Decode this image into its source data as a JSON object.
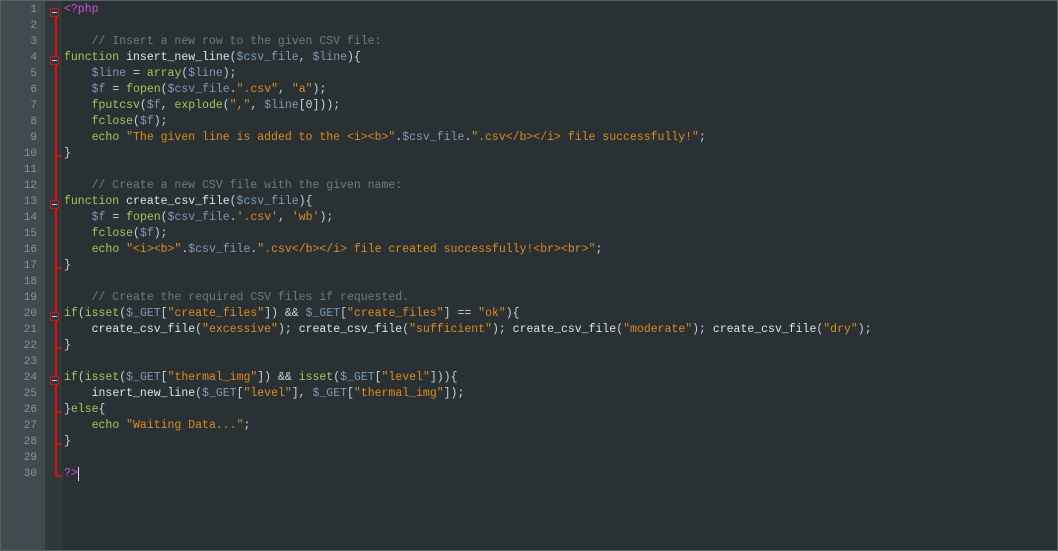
{
  "editor": {
    "current_line": 30,
    "fold_starts": [
      1,
      4,
      13,
      20,
      24
    ],
    "fold_ends": [
      10,
      17,
      22,
      26,
      28,
      30
    ],
    "lines": [
      [
        [
          "php",
          "<?php"
        ]
      ],
      [],
      [
        [
          "com",
          "    // Insert a new row to the given CSV file:"
        ]
      ],
      [
        [
          "kw",
          "function"
        ],
        [
          "fn",
          " insert_new_line"
        ],
        [
          "pun",
          "("
        ],
        [
          "var",
          "$csv_file"
        ],
        [
          "pun",
          ", "
        ],
        [
          "var",
          "$line"
        ],
        [
          "pun",
          "){"
        ]
      ],
      [
        [
          "pun",
          "    "
        ],
        [
          "var",
          "$line"
        ],
        [
          "pun",
          " = "
        ],
        [
          "kw",
          "array"
        ],
        [
          "pun",
          "("
        ],
        [
          "var",
          "$line"
        ],
        [
          "pun",
          ");"
        ]
      ],
      [
        [
          "pun",
          "    "
        ],
        [
          "var",
          "$f"
        ],
        [
          "pun",
          " = "
        ],
        [
          "kw",
          "fopen"
        ],
        [
          "pun",
          "("
        ],
        [
          "var",
          "$csv_file"
        ],
        [
          "pun",
          "."
        ],
        [
          "str",
          "\".csv\""
        ],
        [
          "pun",
          ", "
        ],
        [
          "str",
          "\"a\""
        ],
        [
          "pun",
          ");"
        ]
      ],
      [
        [
          "pun",
          "    "
        ],
        [
          "kw",
          "fputcsv"
        ],
        [
          "pun",
          "("
        ],
        [
          "var",
          "$f"
        ],
        [
          "pun",
          ", "
        ],
        [
          "kw",
          "explode"
        ],
        [
          "pun",
          "("
        ],
        [
          "str",
          "\",\""
        ],
        [
          "pun",
          ", "
        ],
        [
          "var",
          "$line"
        ],
        [
          "pun",
          "[0]));"
        ]
      ],
      [
        [
          "pun",
          "    "
        ],
        [
          "kw",
          "fclose"
        ],
        [
          "pun",
          "("
        ],
        [
          "var",
          "$f"
        ],
        [
          "pun",
          ");"
        ]
      ],
      [
        [
          "pun",
          "    "
        ],
        [
          "kw",
          "echo"
        ],
        [
          "pun",
          " "
        ],
        [
          "str",
          "\"The given line is added to the <i><b>\""
        ],
        [
          "pun",
          "."
        ],
        [
          "var",
          "$csv_file"
        ],
        [
          "pun",
          "."
        ],
        [
          "str",
          "\".csv</b></i> file successfully!\""
        ],
        [
          "pun",
          ";"
        ]
      ],
      [
        [
          "pun",
          "}"
        ]
      ],
      [],
      [
        [
          "com",
          "    // Create a new CSV file with the given name:"
        ]
      ],
      [
        [
          "kw",
          "function"
        ],
        [
          "fn",
          " create_csv_file"
        ],
        [
          "pun",
          "("
        ],
        [
          "var",
          "$csv_file"
        ],
        [
          "pun",
          "){"
        ]
      ],
      [
        [
          "pun",
          "    "
        ],
        [
          "var",
          "$f"
        ],
        [
          "pun",
          " = "
        ],
        [
          "kw",
          "fopen"
        ],
        [
          "pun",
          "("
        ],
        [
          "var",
          "$csv_file"
        ],
        [
          "pun",
          "."
        ],
        [
          "str",
          "'.csv'"
        ],
        [
          "pun",
          ", "
        ],
        [
          "str",
          "'wb'"
        ],
        [
          "pun",
          ");"
        ]
      ],
      [
        [
          "pun",
          "    "
        ],
        [
          "kw",
          "fclose"
        ],
        [
          "pun",
          "("
        ],
        [
          "var",
          "$f"
        ],
        [
          "pun",
          ");"
        ]
      ],
      [
        [
          "pun",
          "    "
        ],
        [
          "kw",
          "echo"
        ],
        [
          "pun",
          " "
        ],
        [
          "str",
          "\"<i><b>\""
        ],
        [
          "pun",
          "."
        ],
        [
          "var",
          "$csv_file"
        ],
        [
          "pun",
          "."
        ],
        [
          "str",
          "\".csv</b></i> file created successfully!<br><br>\""
        ],
        [
          "pun",
          ";"
        ]
      ],
      [
        [
          "pun",
          "}"
        ]
      ],
      [],
      [
        [
          "com",
          "    // Create the required CSV files if requested."
        ]
      ],
      [
        [
          "kw",
          "if"
        ],
        [
          "pun",
          "("
        ],
        [
          "kw",
          "isset"
        ],
        [
          "pun",
          "("
        ],
        [
          "var",
          "$_GET"
        ],
        [
          "pun",
          "["
        ],
        [
          "str",
          "\"create_files\""
        ],
        [
          "pun",
          "]) && "
        ],
        [
          "var",
          "$_GET"
        ],
        [
          "pun",
          "["
        ],
        [
          "str",
          "\"create_files\""
        ],
        [
          "pun",
          "] == "
        ],
        [
          "str",
          "\"ok\""
        ],
        [
          "pun",
          "){"
        ]
      ],
      [
        [
          "pun",
          "    "
        ],
        [
          "fn",
          "create_csv_file"
        ],
        [
          "pun",
          "("
        ],
        [
          "str",
          "\"excessive\""
        ],
        [
          "pun",
          "); "
        ],
        [
          "fn",
          "create_csv_file"
        ],
        [
          "pun",
          "("
        ],
        [
          "str",
          "\"sufficient\""
        ],
        [
          "pun",
          "); "
        ],
        [
          "fn",
          "create_csv_file"
        ],
        [
          "pun",
          "("
        ],
        [
          "str",
          "\"moderate\""
        ],
        [
          "pun",
          "); "
        ],
        [
          "fn",
          "create_csv_file"
        ],
        [
          "pun",
          "("
        ],
        [
          "str",
          "\"dry\""
        ],
        [
          "pun",
          ");"
        ]
      ],
      [
        [
          "pun",
          "}"
        ]
      ],
      [],
      [
        [
          "kw",
          "if"
        ],
        [
          "pun",
          "("
        ],
        [
          "kw",
          "isset"
        ],
        [
          "pun",
          "("
        ],
        [
          "var",
          "$_GET"
        ],
        [
          "pun",
          "["
        ],
        [
          "str",
          "\"thermal_img\""
        ],
        [
          "pun",
          "]) && "
        ],
        [
          "kw",
          "isset"
        ],
        [
          "pun",
          "("
        ],
        [
          "var",
          "$_GET"
        ],
        [
          "pun",
          "["
        ],
        [
          "str",
          "\"level\""
        ],
        [
          "pun",
          "])){"
        ]
      ],
      [
        [
          "pun",
          "    "
        ],
        [
          "fn",
          "insert_new_line"
        ],
        [
          "pun",
          "("
        ],
        [
          "var",
          "$_GET"
        ],
        [
          "pun",
          "["
        ],
        [
          "str",
          "\"level\""
        ],
        [
          "pun",
          "], "
        ],
        [
          "var",
          "$_GET"
        ],
        [
          "pun",
          "["
        ],
        [
          "str",
          "\"thermal_img\""
        ],
        [
          "pun",
          "]);"
        ]
      ],
      [
        [
          "pun",
          "}"
        ],
        [
          "kw",
          "else"
        ],
        [
          "pun",
          "{"
        ]
      ],
      [
        [
          "pun",
          "    "
        ],
        [
          "kw",
          "echo"
        ],
        [
          "pun",
          " "
        ],
        [
          "str",
          "\"Waiting Data...\""
        ],
        [
          "pun",
          ";"
        ]
      ],
      [
        [
          "pun",
          "}"
        ]
      ],
      [],
      [
        [
          "php",
          "?>"
        ]
      ]
    ]
  }
}
